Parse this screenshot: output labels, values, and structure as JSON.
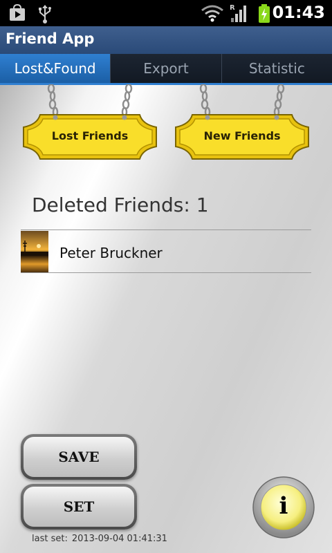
{
  "status_bar": {
    "time": "01:43",
    "icons": [
      "play-store-icon",
      "usb-icon",
      "wifi-icon",
      "roaming-r-icon",
      "signal-icon",
      "battery-charging-icon"
    ],
    "roaming_label": "R"
  },
  "app": {
    "title": "Friend App"
  },
  "tabs": [
    {
      "label": "Lost&Found",
      "active": true
    },
    {
      "label": "Export",
      "active": false
    },
    {
      "label": "Statistic",
      "active": false
    }
  ],
  "signs": {
    "lost_label": "Lost Friends",
    "new_label": "New Friends"
  },
  "deleted": {
    "label": "Deleted Friends: 1"
  },
  "friends": [
    {
      "name": "Peter Bruckner",
      "avatar": "sunset-photo"
    }
  ],
  "buttons": {
    "save_label": "SAVE",
    "set_label": "SET",
    "info_label": "i"
  },
  "last_set": {
    "label": "last set:",
    "value": "2013-09-04 01:41:31"
  },
  "colors": {
    "accent": "#2f7fd1",
    "title_bar": "#2a4a78",
    "sign_gold": "#f5d21a"
  }
}
